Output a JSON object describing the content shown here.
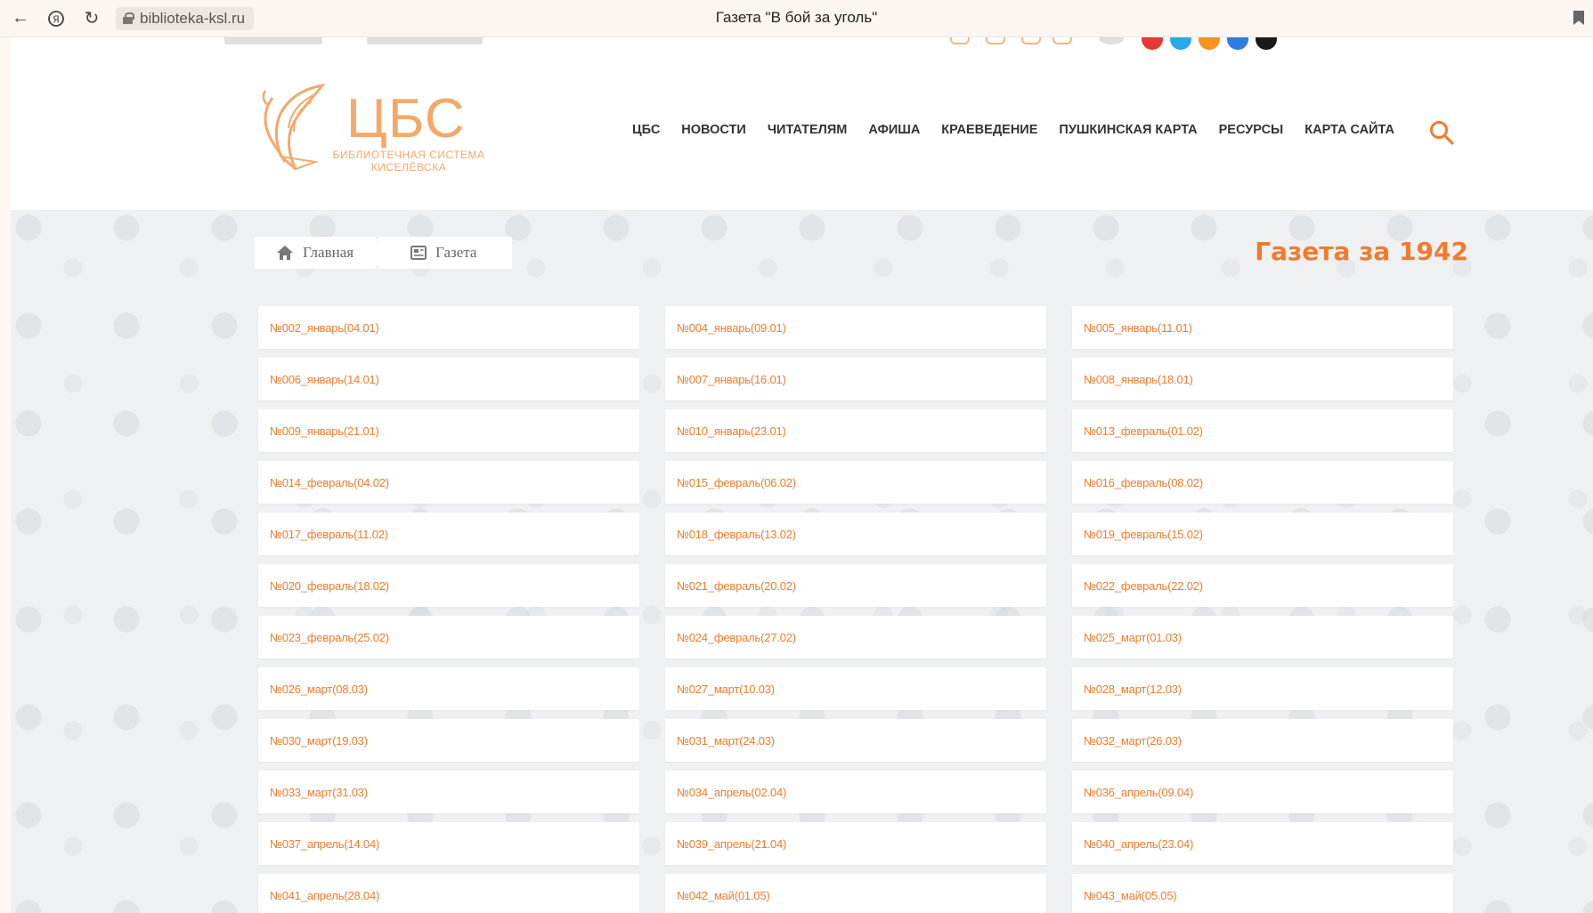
{
  "browser": {
    "url": "biblioteka-ksl.ru",
    "tab_title": "Газета \"В бой за уголь\""
  },
  "colors": {
    "accent": "#f07b2e",
    "logo": "#f4a86a",
    "social": [
      "#e53935",
      "#29a9eb",
      "#f7931e",
      "#2f7de1",
      "#1a1a1a"
    ]
  },
  "logo": {
    "title": "ЦБС",
    "subtitle_line1": "БИБЛИОТЕЧНАЯ СИСТЕМА",
    "subtitle_line2": "КИСЕЛЁВСКА"
  },
  "nav": {
    "items": [
      {
        "label": "ЦБС"
      },
      {
        "label": "НОВОСТИ"
      },
      {
        "label": "ЧИТАТЕЛЯМ"
      },
      {
        "label": "АФИША"
      },
      {
        "label": "КРАЕВЕДЕНИЕ"
      },
      {
        "label": "ПУШКИНСКАЯ КАРТА"
      },
      {
        "label": "РЕСУРСЫ"
      },
      {
        "label": "КАРТА САЙТА"
      }
    ]
  },
  "breadcrumb": {
    "home": "Главная",
    "current": "Газета"
  },
  "heading": "Газета за 1942",
  "issues": [
    "№002_январь(04.01)",
    "№004_январь(09.01)",
    "№005_январь(11.01)",
    "№006_январь(14.01)",
    "№007_январь(16.01)",
    "№008_январь(18.01)",
    "№009_январь(21.01)",
    "№010_январь(23.01)",
    "№013_февраль(01.02)",
    "№014_февраль(04.02)",
    "№015_февраль(06.02)",
    "№016_февраль(08.02)",
    "№017_февраль(11.02)",
    "№018_февраль(13.02)",
    "№019_февраль(15.02)",
    "№020_февраль(18.02)",
    "№021_февраль(20.02)",
    "№022_февраль(22.02)",
    "№023_февраль(25.02)",
    "№024_февраль(27.02)",
    "№025_март(01.03)",
    "№026_март(08.03)",
    "№027_март(10.03)",
    "№028_март(12.03)",
    "№030_март(19.03)",
    "№031_март(24.03)",
    "№032_март(26.03)",
    "№033_март(31.03)",
    "№034_апрель(02.04)",
    "№036_апрель(09.04)",
    "№037_апрель(14.04)",
    "№039_апрель(21.04)",
    "№040_апрель(23.04)",
    "№041_апрель(28.04)",
    "№042_май(01.05)",
    "№043_май(05.05)"
  ]
}
